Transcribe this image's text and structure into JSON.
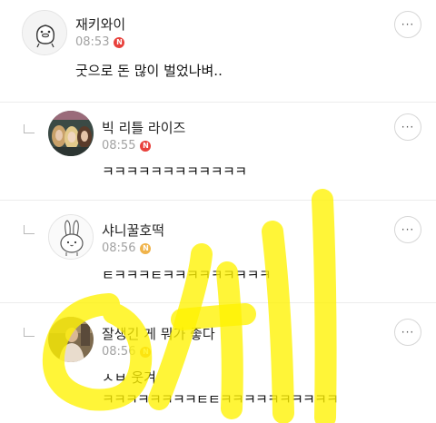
{
  "comments": [
    {
      "author": "재키와이",
      "time": "08:53",
      "badge": "N",
      "badge_color": "#e8413c",
      "text": "굿으로 돈 많이 벌었나벼..",
      "avatar": "duck-character-avatar",
      "is_reply": false
    },
    {
      "author": "빅 리틀 라이즈",
      "time": "08:55",
      "badge": "N",
      "badge_color": "#e8413c",
      "text": "ㅋㅋㅋㅋㅋㅋㅋㅋㅋㅋㅋㅋ",
      "avatar": "poster-photo-avatar",
      "is_reply": true
    },
    {
      "author": "샤니꿀호떡",
      "time": "08:56",
      "badge": "N",
      "badge_color": "#f0b34a",
      "text": "ㅌㅋㅋㅋㅌㅋㅋㅋㅋㅋㅋㅋㅋㅋ",
      "avatar": "rabbit-character-avatar",
      "is_reply": true
    },
    {
      "author": "잘생긴 게 뭐가 좋다",
      "time": "08:56",
      "badge": "N",
      "badge_color": "#f0b34a",
      "text": "ㅅㅂ 웃겨",
      "text2": "ㅋㅋㅋㅋㅋㅋㅋㅋㅌㅌㅋㅋㅋㅋㅋㅋㅋㅋㅋㅋ",
      "avatar": "person-photo-avatar",
      "is_reply": true
    }
  ],
  "more_button_label": "···",
  "overlay": {
    "highlighter_color": "#fff200",
    "description_icon": "handwritten-highlighter-scribble"
  }
}
